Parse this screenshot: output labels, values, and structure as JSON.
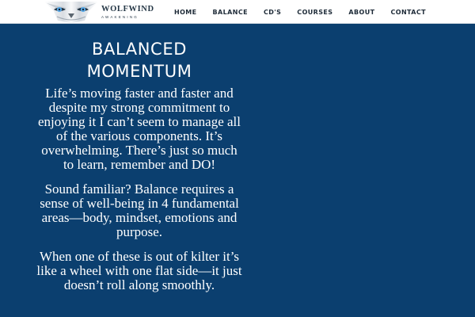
{
  "brand": {
    "name": "WOLFWIND",
    "tagline": "AWAKENING"
  },
  "nav": {
    "items": [
      "HOME",
      "BALANCE",
      "CD'S",
      "COURSES",
      "ABOUT",
      "CONTACT"
    ]
  },
  "page": {
    "title_line_1": "BALANCED",
    "title_line_2": "MOMENTUM",
    "paragraphs": [
      "Life’s moving faster and faster and despite my strong commitment to enjoying it I can’t seem to manage all of the various components. It’s overwhelming. There’s just so much to learn, remember and DO!",
      "Sound familiar? Balance requires a sense of well-being in 4 fundamental areas—body, mindset, emotions and purpose.",
      "When one of these is out of kilter it’s like a wheel with one flat side—it just doesn’t roll along smoothly."
    ]
  },
  "colors": {
    "header_background": "#ffffff",
    "page_background": "#0b3f6f",
    "text": "#ffffff",
    "nav_text": "#1e2b38"
  },
  "icons": {
    "logo": "wolf-eyes-logo"
  }
}
